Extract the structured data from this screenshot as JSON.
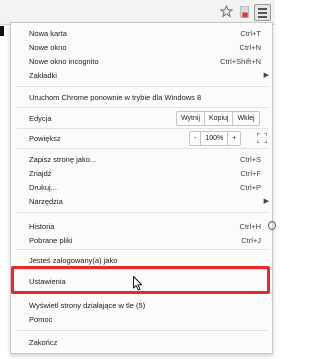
{
  "menu": {
    "items": [
      {
        "label": "Nowa karta",
        "shortcut": "Ctrl+T"
      },
      {
        "label": "Nowe okno",
        "shortcut": "Ctrl+N"
      },
      {
        "label": "Nowe okno incognito",
        "shortcut": "Ctrl+Shift+N"
      },
      {
        "label": "Zakładki",
        "shortcut": ""
      },
      {
        "label": "Uruchom Chrome ponownie w trybie dla Windows 8",
        "shortcut": ""
      },
      {
        "label": "Edycja",
        "shortcut": ""
      },
      {
        "label": "Powiększ",
        "shortcut": ""
      },
      {
        "label": "Zapisz stronę jako...",
        "shortcut": "Ctrl+S"
      },
      {
        "label": "Znajdź",
        "shortcut": "Ctrl+F"
      },
      {
        "label": "Drukuj...",
        "shortcut": "Ctrl+P"
      },
      {
        "label": "Narzędzia",
        "shortcut": ""
      },
      {
        "label": "Historia",
        "shortcut": "Ctrl+H"
      },
      {
        "label": "Pobrane pliki",
        "shortcut": "Ctrl+J"
      },
      {
        "label": "Jesteś zalogowany(a) jako",
        "shortcut": ""
      },
      {
        "label": "Ustawienia",
        "shortcut": ""
      },
      {
        "label": "Wyświetl strony działające w tle (5)",
        "shortcut": ""
      },
      {
        "label": "Pomoc",
        "shortcut": ""
      },
      {
        "label": "Zakończ",
        "shortcut": ""
      }
    ],
    "edit": {
      "cut": "Wytnij",
      "copy": "Kopiuj",
      "paste": "Wklej"
    },
    "zoom": {
      "minus": "-",
      "level": "100%",
      "plus": "+"
    }
  },
  "icons": {
    "star": "star-icon",
    "extension": "extension-icon",
    "menu": "hamburger-menu-icon",
    "submenu": "chevron-right-icon",
    "fullscreen": "fullscreen-icon",
    "cursor": "mouse-cursor-icon"
  },
  "colors": {
    "highlight": "#e8282d"
  }
}
